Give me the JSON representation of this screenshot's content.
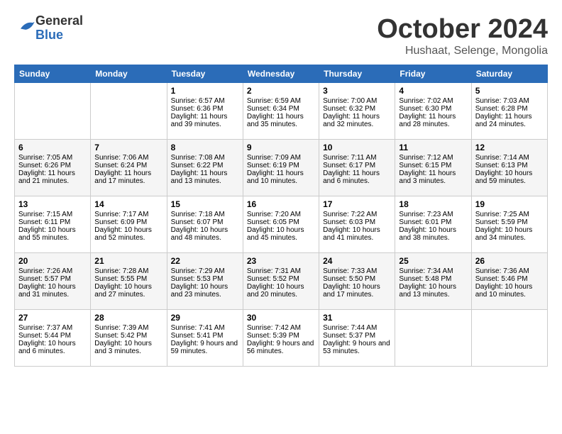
{
  "header": {
    "logo_line1": "General",
    "logo_line2": "Blue",
    "month": "October 2024",
    "location": "Hushaat, Selenge, Mongolia"
  },
  "weekdays": [
    "Sunday",
    "Monday",
    "Tuesday",
    "Wednesday",
    "Thursday",
    "Friday",
    "Saturday"
  ],
  "weeks": [
    [
      {
        "day": "",
        "text": ""
      },
      {
        "day": "",
        "text": ""
      },
      {
        "day": "1",
        "text": "Sunrise: 6:57 AM\nSunset: 6:36 PM\nDaylight: 11 hours and 39 minutes."
      },
      {
        "day": "2",
        "text": "Sunrise: 6:59 AM\nSunset: 6:34 PM\nDaylight: 11 hours and 35 minutes."
      },
      {
        "day": "3",
        "text": "Sunrise: 7:00 AM\nSunset: 6:32 PM\nDaylight: 11 hours and 32 minutes."
      },
      {
        "day": "4",
        "text": "Sunrise: 7:02 AM\nSunset: 6:30 PM\nDaylight: 11 hours and 28 minutes."
      },
      {
        "day": "5",
        "text": "Sunrise: 7:03 AM\nSunset: 6:28 PM\nDaylight: 11 hours and 24 minutes."
      }
    ],
    [
      {
        "day": "6",
        "text": "Sunrise: 7:05 AM\nSunset: 6:26 PM\nDaylight: 11 hours and 21 minutes."
      },
      {
        "day": "7",
        "text": "Sunrise: 7:06 AM\nSunset: 6:24 PM\nDaylight: 11 hours and 17 minutes."
      },
      {
        "day": "8",
        "text": "Sunrise: 7:08 AM\nSunset: 6:22 PM\nDaylight: 11 hours and 13 minutes."
      },
      {
        "day": "9",
        "text": "Sunrise: 7:09 AM\nSunset: 6:19 PM\nDaylight: 11 hours and 10 minutes."
      },
      {
        "day": "10",
        "text": "Sunrise: 7:11 AM\nSunset: 6:17 PM\nDaylight: 11 hours and 6 minutes."
      },
      {
        "day": "11",
        "text": "Sunrise: 7:12 AM\nSunset: 6:15 PM\nDaylight: 11 hours and 3 minutes."
      },
      {
        "day": "12",
        "text": "Sunrise: 7:14 AM\nSunset: 6:13 PM\nDaylight: 10 hours and 59 minutes."
      }
    ],
    [
      {
        "day": "13",
        "text": "Sunrise: 7:15 AM\nSunset: 6:11 PM\nDaylight: 10 hours and 55 minutes."
      },
      {
        "day": "14",
        "text": "Sunrise: 7:17 AM\nSunset: 6:09 PM\nDaylight: 10 hours and 52 minutes."
      },
      {
        "day": "15",
        "text": "Sunrise: 7:18 AM\nSunset: 6:07 PM\nDaylight: 10 hours and 48 minutes."
      },
      {
        "day": "16",
        "text": "Sunrise: 7:20 AM\nSunset: 6:05 PM\nDaylight: 10 hours and 45 minutes."
      },
      {
        "day": "17",
        "text": "Sunrise: 7:22 AM\nSunset: 6:03 PM\nDaylight: 10 hours and 41 minutes."
      },
      {
        "day": "18",
        "text": "Sunrise: 7:23 AM\nSunset: 6:01 PM\nDaylight: 10 hours and 38 minutes."
      },
      {
        "day": "19",
        "text": "Sunrise: 7:25 AM\nSunset: 5:59 PM\nDaylight: 10 hours and 34 minutes."
      }
    ],
    [
      {
        "day": "20",
        "text": "Sunrise: 7:26 AM\nSunset: 5:57 PM\nDaylight: 10 hours and 31 minutes."
      },
      {
        "day": "21",
        "text": "Sunrise: 7:28 AM\nSunset: 5:55 PM\nDaylight: 10 hours and 27 minutes."
      },
      {
        "day": "22",
        "text": "Sunrise: 7:29 AM\nSunset: 5:53 PM\nDaylight: 10 hours and 23 minutes."
      },
      {
        "day": "23",
        "text": "Sunrise: 7:31 AM\nSunset: 5:52 PM\nDaylight: 10 hours and 20 minutes."
      },
      {
        "day": "24",
        "text": "Sunrise: 7:33 AM\nSunset: 5:50 PM\nDaylight: 10 hours and 17 minutes."
      },
      {
        "day": "25",
        "text": "Sunrise: 7:34 AM\nSunset: 5:48 PM\nDaylight: 10 hours and 13 minutes."
      },
      {
        "day": "26",
        "text": "Sunrise: 7:36 AM\nSunset: 5:46 PM\nDaylight: 10 hours and 10 minutes."
      }
    ],
    [
      {
        "day": "27",
        "text": "Sunrise: 7:37 AM\nSunset: 5:44 PM\nDaylight: 10 hours and 6 minutes."
      },
      {
        "day": "28",
        "text": "Sunrise: 7:39 AM\nSunset: 5:42 PM\nDaylight: 10 hours and 3 minutes."
      },
      {
        "day": "29",
        "text": "Sunrise: 7:41 AM\nSunset: 5:41 PM\nDaylight: 9 hours and 59 minutes."
      },
      {
        "day": "30",
        "text": "Sunrise: 7:42 AM\nSunset: 5:39 PM\nDaylight: 9 hours and 56 minutes."
      },
      {
        "day": "31",
        "text": "Sunrise: 7:44 AM\nSunset: 5:37 PM\nDaylight: 9 hours and 53 minutes."
      },
      {
        "day": "",
        "text": ""
      },
      {
        "day": "",
        "text": ""
      }
    ]
  ]
}
